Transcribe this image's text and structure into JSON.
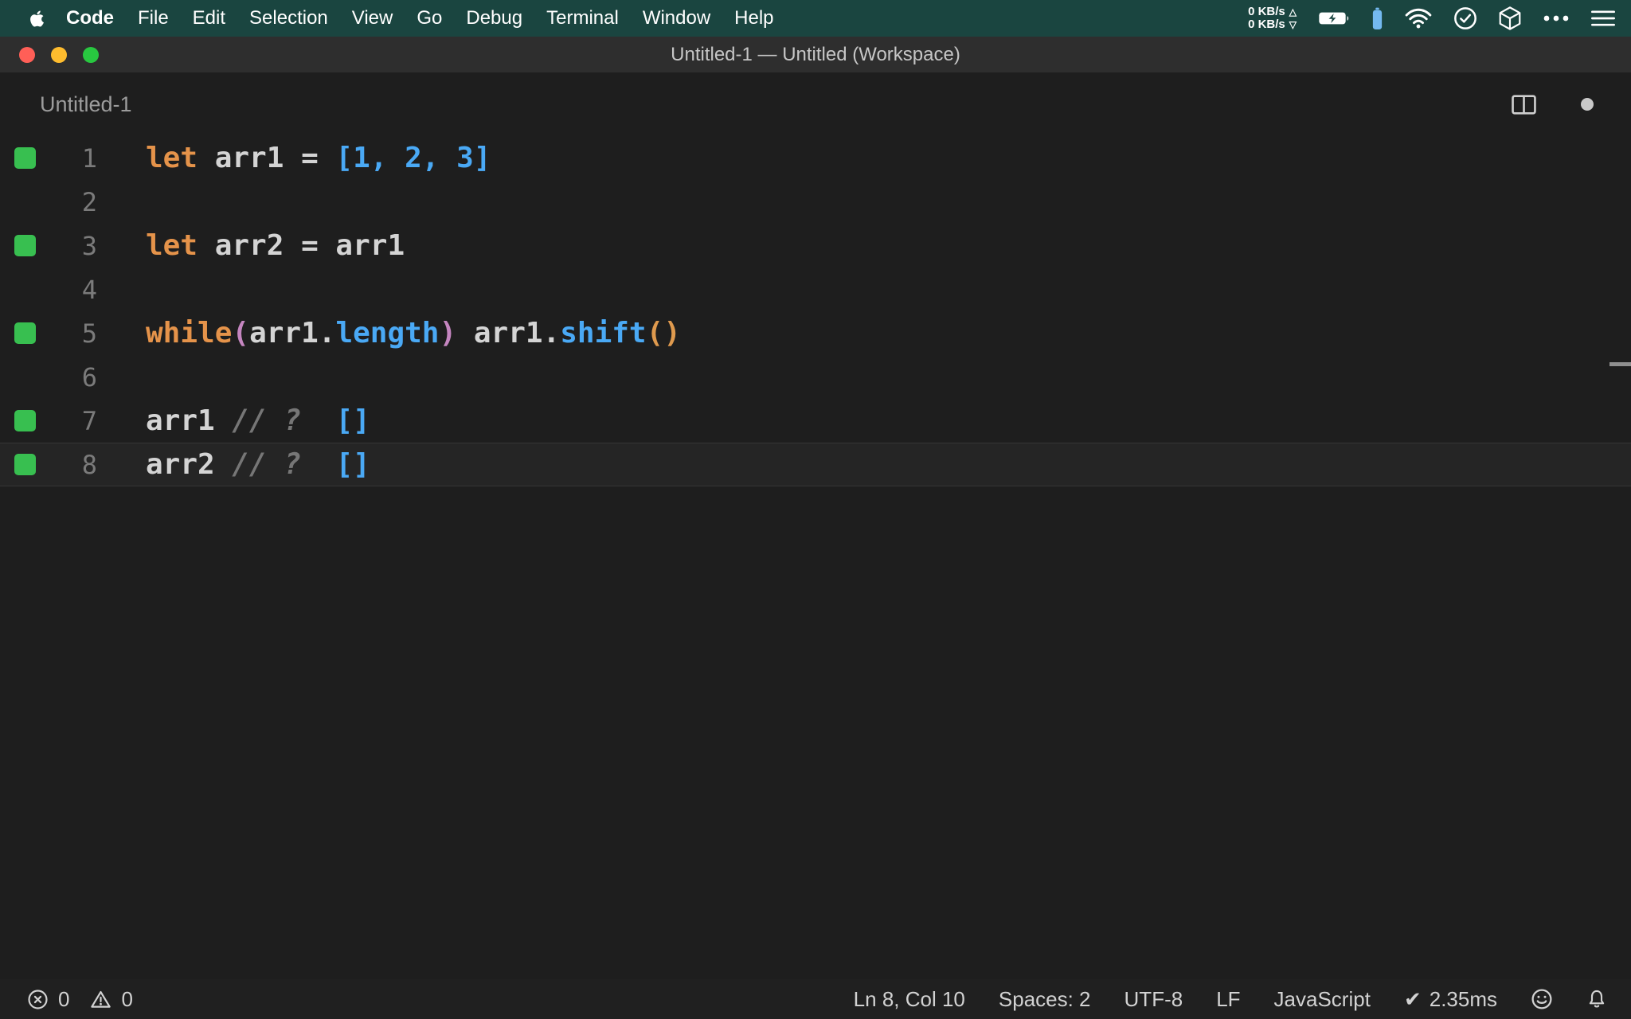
{
  "colors": {
    "menubar_bg": "#1a4540",
    "titlebar_bg": "#2e2e2e",
    "editor_bg": "#1e1e1e",
    "statusbar_bg": "#202020",
    "traffic_red": "#ff5f57",
    "traffic_yellow": "#febc2e",
    "traffic_green": "#28c840",
    "marker_green": "#38bf50",
    "device_battery_blue": "#74b9f0"
  },
  "menu_bar": {
    "items": [
      {
        "label": "Code",
        "bold": true
      },
      {
        "label": "File"
      },
      {
        "label": "Edit"
      },
      {
        "label": "Selection"
      },
      {
        "label": "View"
      },
      {
        "label": "Go"
      },
      {
        "label": "Debug"
      },
      {
        "label": "Terminal"
      },
      {
        "label": "Window"
      },
      {
        "label": "Help"
      }
    ],
    "net_up": "0 KB/s",
    "net_down": "0 KB/s",
    "up_arrow": "△",
    "down_arrow": "▽"
  },
  "title_bar": {
    "title": "Untitled-1 — Untitled (Workspace)"
  },
  "tab": {
    "label": "Untitled-1"
  },
  "editor": {
    "token_colors": {
      "keyword": "#e5934a",
      "plain": "#d4d4d4",
      "blue": "#4aa9f5",
      "magenta": "#c586c0",
      "orange": "#df9a4e",
      "comment": "#767676"
    },
    "lines": [
      {
        "num": "1",
        "marker": true,
        "active": false,
        "tokens": [
          [
            "keyword",
            "let"
          ],
          [
            "plain",
            " arr1 = "
          ],
          [
            "blue",
            "[1, 2, 3]"
          ]
        ]
      },
      {
        "num": "2",
        "marker": false,
        "active": false,
        "tokens": []
      },
      {
        "num": "3",
        "marker": true,
        "active": false,
        "tokens": [
          [
            "keyword",
            "let"
          ],
          [
            "plain",
            " arr2 = arr1"
          ]
        ]
      },
      {
        "num": "4",
        "marker": false,
        "active": false,
        "tokens": []
      },
      {
        "num": "5",
        "marker": true,
        "active": false,
        "tokens": [
          [
            "keyword",
            "while"
          ],
          [
            "magenta",
            "("
          ],
          [
            "plain",
            "arr1."
          ],
          [
            "blue",
            "length"
          ],
          [
            "magenta",
            ")"
          ],
          [
            "plain",
            " arr1."
          ],
          [
            "blue",
            "shift"
          ],
          [
            "orange",
            "()"
          ]
        ]
      },
      {
        "num": "6",
        "marker": false,
        "active": false,
        "tokens": []
      },
      {
        "num": "7",
        "marker": true,
        "active": false,
        "tokens": [
          [
            "plain",
            "arr1 "
          ],
          [
            "comment",
            "// ?"
          ],
          [
            "plain",
            "  "
          ],
          [
            "blue",
            "[]"
          ]
        ]
      },
      {
        "num": "8",
        "marker": true,
        "active": true,
        "tokens": [
          [
            "plain",
            "arr2 "
          ],
          [
            "comment",
            "// ?"
          ],
          [
            "plain",
            "  "
          ],
          [
            "blue",
            "[]"
          ]
        ]
      }
    ]
  },
  "status_bar": {
    "errors_count": "0",
    "warnings_count": "0",
    "cursor": "Ln 8, Col 10",
    "indent": "Spaces: 2",
    "encoding": "UTF-8",
    "eol": "LF",
    "language": "JavaScript",
    "quokka_check": "✔",
    "quokka_time": "2.35ms"
  }
}
